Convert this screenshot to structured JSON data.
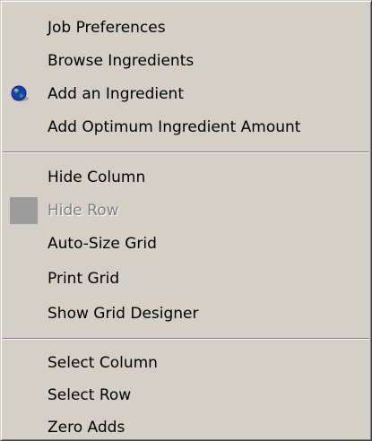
{
  "menu": {
    "items": [
      {
        "label": "Job Preferences"
      },
      {
        "label": "Browse Ingredients"
      },
      {
        "label": "Add an Ingredient",
        "icon": "globe-icon"
      },
      {
        "label": "Add Optimum Ingredient Amount"
      },
      {
        "label": "Hide Column"
      },
      {
        "label": "Hide Row",
        "disabled": true,
        "icon": "gray-square-icon"
      },
      {
        "label": "Auto-Size Grid"
      },
      {
        "label": "Print Grid"
      },
      {
        "label": "Show Grid Designer"
      },
      {
        "label": "Select Column"
      },
      {
        "label": "Select Row"
      },
      {
        "label": "Zero Adds"
      }
    ]
  },
  "colors": {
    "menu_background": "#d4d0c8",
    "disabled_text": "#808080",
    "icon_box": "#9c9c9c"
  }
}
